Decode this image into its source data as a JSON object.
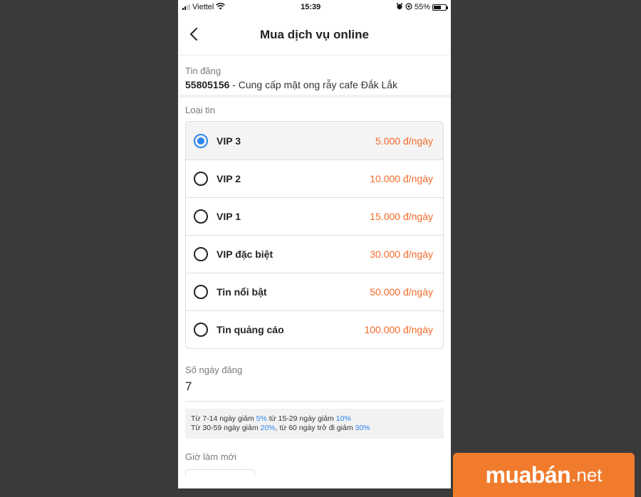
{
  "status_bar": {
    "carrier": "Viettel",
    "time": "15:39",
    "battery": "55%"
  },
  "header": {
    "title": "Mua dịch vụ online",
    "back_icon": "chevron-left-icon"
  },
  "post": {
    "label": "Tin đăng",
    "id": "55805156",
    "title": " - Cung cấp mặt ong rẫy cafe Đắk Lắk"
  },
  "listing_type": {
    "label": "Loại tin",
    "selected": "VIP 3",
    "options": [
      {
        "name": "VIP 3",
        "price": "5.000 đ/ngày"
      },
      {
        "name": "VIP 2",
        "price": "10.000 đ/ngày"
      },
      {
        "name": "VIP 1",
        "price": "15.000 đ/ngày"
      },
      {
        "name": "VIP đặc biệt",
        "price": "30.000 đ/ngày"
      },
      {
        "name": "Tin nổi bật",
        "price": "50.000 đ/ngày"
      },
      {
        "name": "Tin quảng cáo",
        "price": "100.000 đ/ngày"
      }
    ]
  },
  "days": {
    "label": "Số ngày đăng",
    "value": "7",
    "discount": {
      "l1_a": "Từ 7-14 ngày giảm ",
      "l1_b": "5%",
      "l1_c": " từ 15-29 ngày giảm ",
      "l1_d": "10%",
      "l2_a": "Từ 30-59 ngày giảm ",
      "l2_b": "20%",
      "l2_c": ", từ 60 ngày trở đi giảm ",
      "l2_d": "30%"
    }
  },
  "refresh": {
    "label": "Giờ làm mới"
  },
  "brand": {
    "name": "muabán",
    "suffix": ".net"
  },
  "colors": {
    "accent": "#2a86f0",
    "price": "#f26b2a",
    "brand": "#f07b2c"
  }
}
